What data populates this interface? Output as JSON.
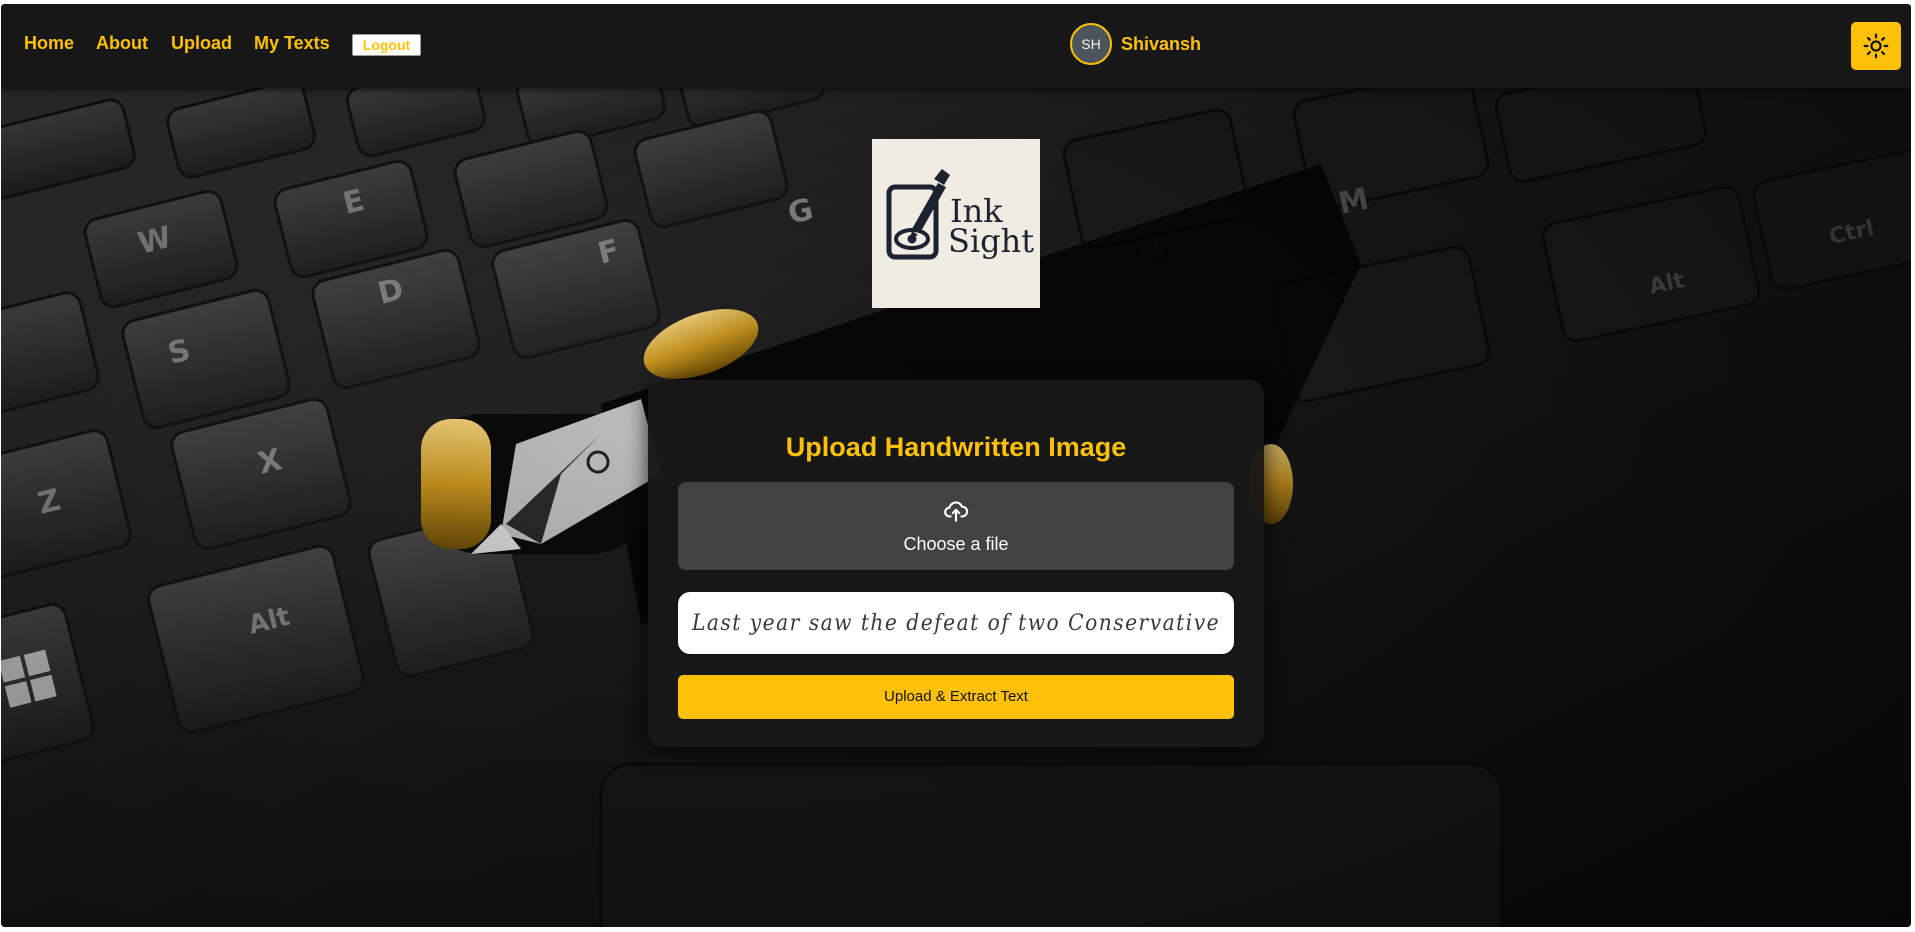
{
  "nav": {
    "links": [
      "Home",
      "About",
      "Upload",
      "My Texts"
    ],
    "logout_label": "Logout",
    "user": {
      "initials": "SH",
      "name": "Shivansh"
    },
    "theme_toggle_icon": "sun-icon"
  },
  "logo": {
    "line1": "Ink",
    "line2": "Sight"
  },
  "upload": {
    "title": "Upload Handwritten Image",
    "file_label": "Choose a file",
    "file_icon": "cloud-upload-icon",
    "preview_text": "Last year saw the defeat of two Conservative",
    "button_label": "Upload & Extract Text"
  },
  "colors": {
    "accent": "#ffc107",
    "navbar_bg": "#171717",
    "card_bg": "#181818",
    "file_drop_bg": "#424242",
    "logo_bg": "#f1ece2"
  }
}
